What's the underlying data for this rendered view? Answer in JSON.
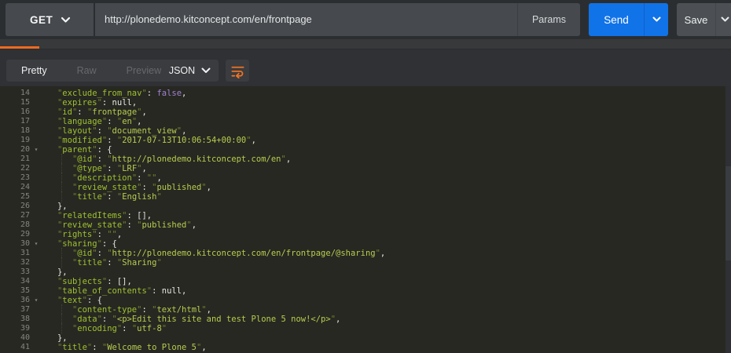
{
  "request": {
    "method": "GET",
    "url": "http://plonedemo.kitconcept.com/en/frontpage",
    "params_label": "Params",
    "send_label": "Send",
    "save_label": "Save"
  },
  "response": {
    "tabs": [
      {
        "label": "Pretty",
        "active": true
      },
      {
        "label": "Raw",
        "active": false
      },
      {
        "label": "Preview",
        "active": false
      }
    ],
    "format": "JSON",
    "accent_orange": "#ee6b20",
    "send_blue": "#1173e8",
    "icons": [
      "wrap-text-icon",
      "copy-icon",
      "search-icon"
    ]
  },
  "code": {
    "language": "json",
    "first_line": 14,
    "last_line": 41,
    "lines": [
      {
        "n": 14,
        "f": 0,
        "g": 0,
        "t": [
          [
            "   ",
            "p"
          ],
          [
            "exclude_from_nav",
            "k"
          ],
          [
            ": ",
            "p"
          ],
          [
            "false",
            "v"
          ],
          [
            ",",
            "p"
          ]
        ]
      },
      {
        "n": 15,
        "f": 0,
        "g": 0,
        "t": [
          [
            "   ",
            "p"
          ],
          [
            "expires",
            "k"
          ],
          [
            ": ",
            "p"
          ],
          [
            "null",
            "p"
          ],
          [
            ",",
            "p"
          ]
        ]
      },
      {
        "n": 16,
        "f": 0,
        "g": 0,
        "t": [
          [
            "   ",
            "p"
          ],
          [
            "id",
            "k"
          ],
          [
            ": ",
            "p"
          ],
          [
            "frontpage",
            "s"
          ],
          [
            ",",
            "p"
          ]
        ]
      },
      {
        "n": 17,
        "f": 0,
        "g": 0,
        "t": [
          [
            "   ",
            "p"
          ],
          [
            "language",
            "k"
          ],
          [
            ": ",
            "p"
          ],
          [
            "en",
            "s"
          ],
          [
            ",",
            "p"
          ]
        ]
      },
      {
        "n": 18,
        "f": 0,
        "g": 0,
        "t": [
          [
            "   ",
            "p"
          ],
          [
            "layout",
            "k"
          ],
          [
            ": ",
            "p"
          ],
          [
            "document_view",
            "s"
          ],
          [
            ",",
            "p"
          ]
        ]
      },
      {
        "n": 19,
        "f": 0,
        "g": 0,
        "t": [
          [
            "   ",
            "p"
          ],
          [
            "modified",
            "k"
          ],
          [
            ": ",
            "p"
          ],
          [
            "2017-07-13T10:06:54+00:00",
            "s"
          ],
          [
            ",",
            "p"
          ]
        ]
      },
      {
        "n": 20,
        "f": 1,
        "g": 0,
        "t": [
          [
            "   ",
            "p"
          ],
          [
            "parent",
            "k"
          ],
          [
            ": ",
            "p"
          ],
          [
            "{",
            "p"
          ]
        ]
      },
      {
        "n": 21,
        "f": 0,
        "g": 1,
        "t": [
          [
            "      ",
            "p"
          ],
          [
            "@id",
            "k"
          ],
          [
            ": ",
            "p"
          ],
          [
            "http://plonedemo.kitconcept.com/en",
            "s"
          ],
          [
            ",",
            "p"
          ]
        ]
      },
      {
        "n": 22,
        "f": 0,
        "g": 1,
        "t": [
          [
            "      ",
            "p"
          ],
          [
            "@type",
            "k"
          ],
          [
            ": ",
            "p"
          ],
          [
            "LRF",
            "s"
          ],
          [
            ",",
            "p"
          ]
        ]
      },
      {
        "n": 23,
        "f": 0,
        "g": 1,
        "t": [
          [
            "      ",
            "p"
          ],
          [
            "description",
            "k"
          ],
          [
            ": ",
            "p"
          ],
          [
            "",
            "s"
          ],
          [
            ",",
            "p"
          ]
        ]
      },
      {
        "n": 24,
        "f": 0,
        "g": 1,
        "t": [
          [
            "      ",
            "p"
          ],
          [
            "review_state",
            "k"
          ],
          [
            ": ",
            "p"
          ],
          [
            "published",
            "s"
          ],
          [
            ",",
            "p"
          ]
        ]
      },
      {
        "n": 25,
        "f": 0,
        "g": 1,
        "t": [
          [
            "      ",
            "p"
          ],
          [
            "title",
            "k"
          ],
          [
            ": ",
            "p"
          ],
          [
            "English",
            "s"
          ]
        ]
      },
      {
        "n": 26,
        "f": 0,
        "g": 0,
        "t": [
          [
            "   ",
            "p"
          ],
          [
            "},",
            "p"
          ]
        ]
      },
      {
        "n": 27,
        "f": 0,
        "g": 0,
        "t": [
          [
            "   ",
            "p"
          ],
          [
            "relatedItems",
            "k"
          ],
          [
            ": ",
            "p"
          ],
          [
            "[],",
            "p"
          ]
        ]
      },
      {
        "n": 28,
        "f": 0,
        "g": 0,
        "t": [
          [
            "   ",
            "p"
          ],
          [
            "review_state",
            "k"
          ],
          [
            ": ",
            "p"
          ],
          [
            "published",
            "s"
          ],
          [
            ",",
            "p"
          ]
        ]
      },
      {
        "n": 29,
        "f": 0,
        "g": 0,
        "t": [
          [
            "   ",
            "p"
          ],
          [
            "rights",
            "k"
          ],
          [
            ": ",
            "p"
          ],
          [
            "",
            "s"
          ],
          [
            ",",
            "p"
          ]
        ]
      },
      {
        "n": 30,
        "f": 1,
        "g": 0,
        "t": [
          [
            "   ",
            "p"
          ],
          [
            "sharing",
            "k"
          ],
          [
            ": ",
            "p"
          ],
          [
            "{",
            "p"
          ]
        ]
      },
      {
        "n": 31,
        "f": 0,
        "g": 1,
        "t": [
          [
            "      ",
            "p"
          ],
          [
            "@id",
            "k"
          ],
          [
            ": ",
            "p"
          ],
          [
            "http://plonedemo.kitconcept.com/en/frontpage/@sharing",
            "s"
          ],
          [
            ",",
            "p"
          ]
        ]
      },
      {
        "n": 32,
        "f": 0,
        "g": 1,
        "t": [
          [
            "      ",
            "p"
          ],
          [
            "title",
            "k"
          ],
          [
            ": ",
            "p"
          ],
          [
            "Sharing",
            "s"
          ]
        ]
      },
      {
        "n": 33,
        "f": 0,
        "g": 0,
        "t": [
          [
            "   ",
            "p"
          ],
          [
            "},",
            "p"
          ]
        ]
      },
      {
        "n": 34,
        "f": 0,
        "g": 0,
        "t": [
          [
            "   ",
            "p"
          ],
          [
            "subjects",
            "k"
          ],
          [
            ": ",
            "p"
          ],
          [
            "[],",
            "p"
          ]
        ]
      },
      {
        "n": 35,
        "f": 0,
        "g": 0,
        "t": [
          [
            "   ",
            "p"
          ],
          [
            "table_of_contents",
            "k"
          ],
          [
            ": ",
            "p"
          ],
          [
            "null",
            "p"
          ],
          [
            ",",
            "p"
          ]
        ]
      },
      {
        "n": 36,
        "f": 1,
        "g": 0,
        "t": [
          [
            "   ",
            "p"
          ],
          [
            "text",
            "k"
          ],
          [
            ": ",
            "p"
          ],
          [
            "{",
            "p"
          ]
        ]
      },
      {
        "n": 37,
        "f": 0,
        "g": 1,
        "t": [
          [
            "      ",
            "p"
          ],
          [
            "content-type",
            "k"
          ],
          [
            ": ",
            "p"
          ],
          [
            "text/html",
            "s"
          ],
          [
            ",",
            "p"
          ]
        ]
      },
      {
        "n": 38,
        "f": 0,
        "g": 1,
        "t": [
          [
            "      ",
            "p"
          ],
          [
            "data",
            "k"
          ],
          [
            ": ",
            "p"
          ],
          [
            "<p>Edit this site and test Plone 5 now!</p>",
            "s"
          ],
          [
            ",",
            "p"
          ]
        ]
      },
      {
        "n": 39,
        "f": 0,
        "g": 1,
        "t": [
          [
            "      ",
            "p"
          ],
          [
            "encoding",
            "k"
          ],
          [
            ": ",
            "p"
          ],
          [
            "utf-8",
            "s"
          ]
        ]
      },
      {
        "n": 40,
        "f": 0,
        "g": 0,
        "t": [
          [
            "   ",
            "p"
          ],
          [
            "},",
            "p"
          ]
        ]
      },
      {
        "n": 41,
        "f": 0,
        "g": 0,
        "t": [
          [
            "   ",
            "p"
          ],
          [
            "title",
            "k"
          ],
          [
            ": ",
            "p"
          ],
          [
            "Welcome to Plone 5",
            "s"
          ],
          [
            ",",
            "p"
          ]
        ]
      }
    ]
  }
}
